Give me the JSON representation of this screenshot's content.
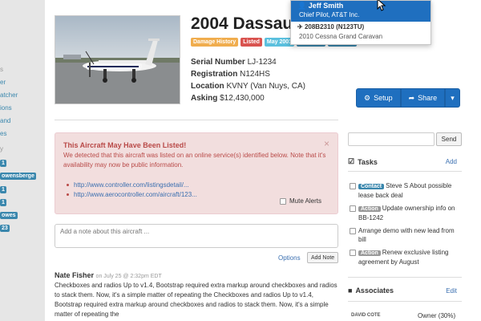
{
  "sidebar": {
    "fragments": [
      "s",
      "er",
      "atcher",
      "ions",
      "and",
      "es",
      "y"
    ],
    "badges": [
      "1",
      "owensberge",
      "1",
      "1",
      "owes",
      "23"
    ]
  },
  "listing": {
    "title": "2004 Dassaul",
    "tags": [
      {
        "label": "Damage History",
        "color": "#f0ad4e"
      },
      {
        "label": "Listed",
        "color": "#d9534f"
      },
      {
        "label": "May 2001",
        "color": "#5bc0de"
      },
      {
        "label": "",
        "color": "#3a87ad"
      },
      {
        "label": "",
        "color": "#3a87ad"
      }
    ],
    "serial_label": "Serial Number",
    "serial_value": "LJ-1234",
    "registration_label": "Registration",
    "registration_value": "N124HS",
    "location_label": "Location",
    "location_value": "KVNY (Van Nuys, CA)",
    "asking_label": "Asking",
    "asking_value": "$12,430,000"
  },
  "actions": {
    "setup_label": "Setup",
    "share_label": "Share"
  },
  "alert": {
    "title": "This Aircraft May Have Been Listed!",
    "body": "We detected that this aircraft was listed on an online service(s) identified below. Note that it's availability may now be public information.",
    "links": [
      "http://www.controller.com/listingsdetail/...",
      "http://www.aerocontroller.com/aircraft/123..."
    ],
    "mute_label": "Mute Alerts",
    "close": "×"
  },
  "note": {
    "placeholder": "Add a note about this aircraft ...",
    "options_label": "Options",
    "add_label": "Add Note"
  },
  "post": {
    "author": "Nate Fisher",
    "meta": "on July 25 @ 2:32pm EDT",
    "body": "Checkboxes and radios Up to v1.4, Bootstrap required extra markup around checkboxes and radios to stack them. Now, it's a simple matter of repeating the Checkboxes and radios Up to v1.4, Bootstrap required extra markup around checkboxes and radios to stack them. Now, it's a simple matter of repeating the"
  },
  "send": {
    "label": "Send"
  },
  "tasks": {
    "title": "Tasks",
    "add_label": "Add",
    "items": [
      {
        "pill": "Contact",
        "pill_color": "#3a87ad",
        "text": "Steve S About possible lease back deal"
      },
      {
        "pill": "Action",
        "pill_color": "#999999",
        "text": "Update ownership info on BB-1242"
      },
      {
        "pill": "",
        "pill_color": "",
        "text": "Arrange demo with new lead from bill"
      },
      {
        "pill": "Action",
        "pill_color": "#999999",
        "text": "Renew exclusive listing agreement by August"
      }
    ]
  },
  "associates": {
    "title": "Associates",
    "edit_label": "Edit",
    "rows": [
      {
        "name": "DAVID COTE",
        "role": "Owner (30%)"
      }
    ]
  },
  "dropdown": {
    "items": [
      {
        "name": "Jeff Smith",
        "detail": "Chief Pilot, AT&T Inc.",
        "icon": "user-icon",
        "selected": true
      },
      {
        "name": "208B2310 (N123TU)",
        "detail": "2010 Cessna Grand Caravan",
        "icon": "plane-icon",
        "selected": false
      }
    ]
  }
}
